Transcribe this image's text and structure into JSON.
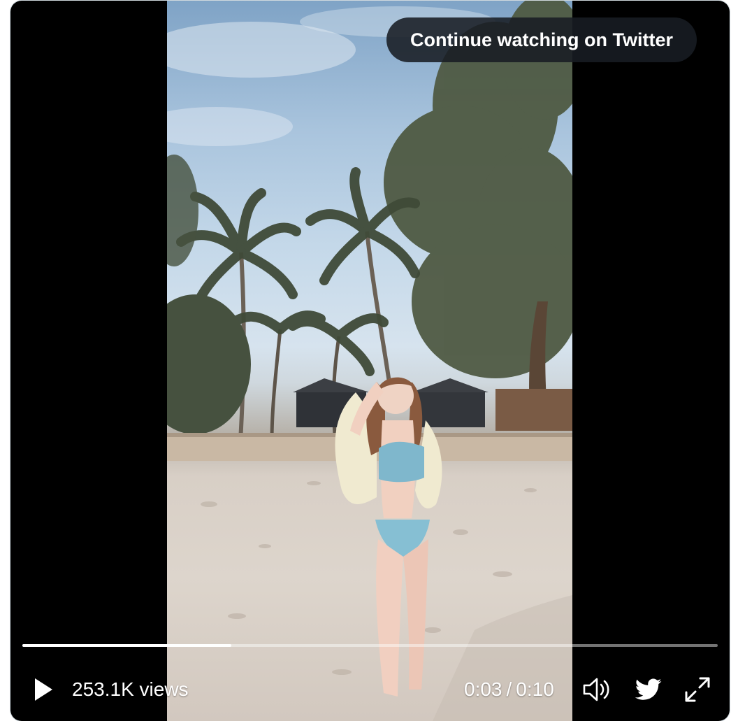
{
  "overlay": {
    "continue_label": "Continue watching on Twitter"
  },
  "player": {
    "views": "253.1K views",
    "current_time": "0:03",
    "time_separator": "/",
    "duration": "0:10",
    "progress_fraction": 0.3
  },
  "icons": {
    "play": "play-icon",
    "volume": "volume-icon",
    "twitter": "twitter-bird-icon",
    "fullscreen": "fullscreen-icon"
  },
  "colors": {
    "twitter_blue": "#1d9bf0"
  }
}
